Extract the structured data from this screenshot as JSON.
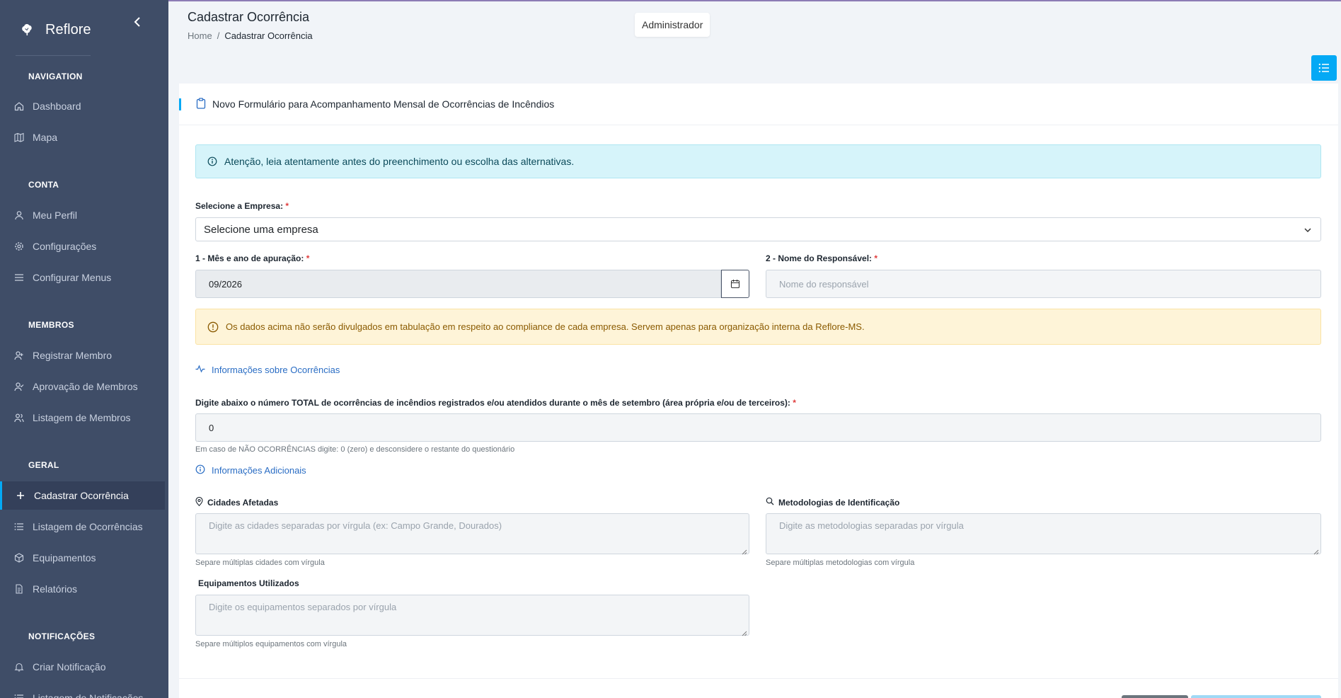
{
  "brand": {
    "name": "Reflore",
    "logo": "tree-icon"
  },
  "sidebar": {
    "collapse_icon": "chevron-left-icon",
    "sections": {
      "navigation": "NAVIGATION",
      "conta": "CONTA",
      "membros": "MEMBROS",
      "geral": "GERAL",
      "notificacoes": "NOTIFICAÇÕES"
    },
    "items": [
      {
        "label": "Dashboard",
        "icon": "home-icon"
      },
      {
        "label": "Mapa",
        "icon": "map-icon"
      },
      {
        "label": "Meu Perfil",
        "icon": "user-icon"
      },
      {
        "label": "Configurações",
        "icon": "gear-icon"
      },
      {
        "label": "Configurar Menus",
        "icon": "menu-icon"
      },
      {
        "label": "Registrar Membro",
        "icon": "user-plus-icon"
      },
      {
        "label": "Aprovação de Membros",
        "icon": "user-check-icon"
      },
      {
        "label": "Listagem de Membros",
        "icon": "users-icon"
      },
      {
        "label": "Cadastrar Ocorrência",
        "icon": "plus-icon",
        "active": true
      },
      {
        "label": "Listagem de Ocorrências",
        "icon": "list-icon"
      },
      {
        "label": "Equipamentos",
        "icon": "box-icon"
      },
      {
        "label": "Relatórios",
        "icon": "file-text-icon"
      },
      {
        "label": "Criar Notificação",
        "icon": "bell-icon"
      },
      {
        "label": "Listagem de Notificações",
        "icon": "list-icon"
      }
    ]
  },
  "header": {
    "title": "Cadastrar Ocorrência",
    "breadcrumb": {
      "home": "Home",
      "sep": "/",
      "current": "Cadastrar Ocorrência"
    },
    "user": "Administrador"
  },
  "form": {
    "card_title": "Novo Formulário para Acompanhamento Mensal de Ocorrências de Incêndios",
    "info_alert": "Atenção, leia atentamente antes do preenchimento ou escolha das alternativas.",
    "empresa": {
      "label": "Selecione a Empresa:",
      "required": "*",
      "value": "Selecione uma empresa"
    },
    "mes_ano": {
      "label": "1 - Mês e ano de apuração:",
      "required": "*",
      "value": "09/2026"
    },
    "responsavel": {
      "label": "2 - Nome do Responsável:",
      "required": "*",
      "placeholder": "Nome do responsável"
    },
    "warn_alert": "Os dados acima não serão divulgados em tabulação em respeito ao compliance de cada empresa. Servem apenas para organização interna da Reflore-MS.",
    "section_ocorrencias": "Informações sobre Ocorrências",
    "total": {
      "label": "Digite abaixo o número TOTAL de ocorrências de incêndios registrados e/ou atendidos durante o mês de setembro (área própria e/ou de terceiros):",
      "required": "*",
      "value": "0",
      "help": "Em caso de NÃO OCORRÊNCIAS digite: 0 (zero) e desconsidere o restante do questionário"
    },
    "section_adicionais": "Informações Adicionais",
    "cidades": {
      "label": "Cidades Afetadas",
      "placeholder": "Digite as cidades separadas por vírgula (ex: Campo Grande, Dourados)",
      "help": "Separe múltiplas cidades com vírgula"
    },
    "metodologias": {
      "label": "Metodologias de Identificação",
      "placeholder": "Digite as metodologias separadas por vírgula",
      "help": "Separe múltiplas metodologias com vírgula"
    },
    "equipamentos": {
      "label": "Equipamentos Utilizados",
      "placeholder": "Digite os equipamentos separados por vírgula",
      "help": "Separe múltiplos equipamentos com vírgula"
    }
  },
  "colors": {
    "sidebar": "#3f4d67",
    "accent": "#04a9f5",
    "info_bg": "#d6f4fa",
    "warn_bg": "#fef4d8",
    "required": "#e03c3c"
  }
}
